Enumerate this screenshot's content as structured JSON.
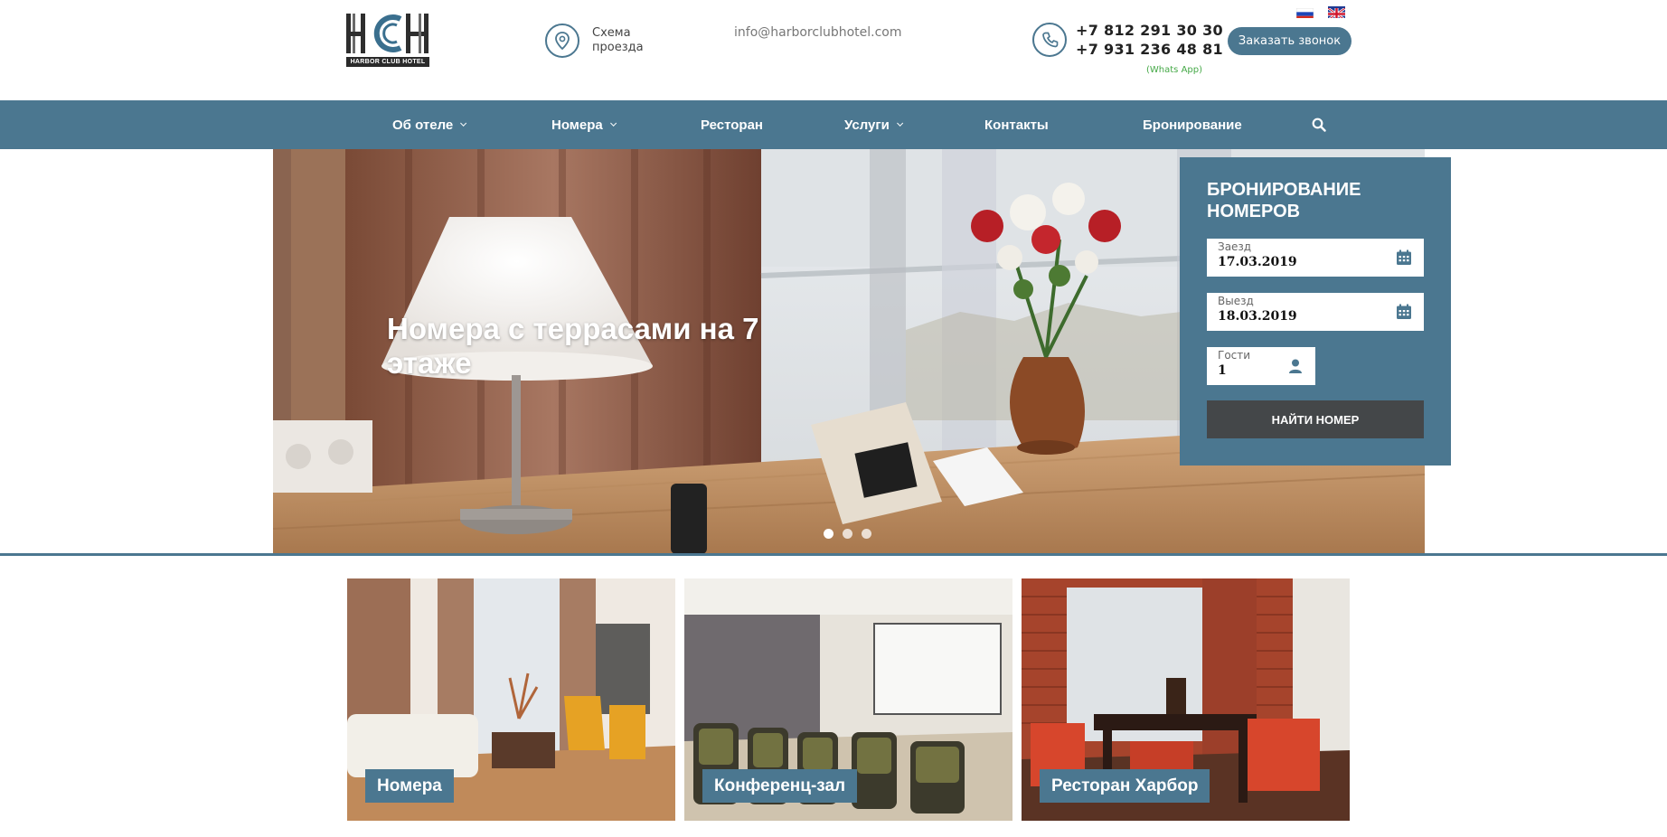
{
  "brand": {
    "logo_letters": "HCH",
    "logo_caption": "HARBOR CLUB HOTEL"
  },
  "header": {
    "map_link": "Схема проезда",
    "email": "info@harborclubhotel.com",
    "phone_1": "+7 812 291 30 30",
    "phone_2": "+7 931 236 48 81",
    "whatsapp": "(Whats App)",
    "callback_button": "Заказать звонок",
    "languages": [
      "ru",
      "en"
    ]
  },
  "nav": {
    "items": [
      {
        "label": "Об отеле",
        "dropdown": true
      },
      {
        "label": "Номера",
        "dropdown": true
      },
      {
        "label": "Ресторан",
        "dropdown": false
      },
      {
        "label": "Услуги",
        "dropdown": true
      },
      {
        "label": "Контакты",
        "dropdown": false
      },
      {
        "label": "Бронирование",
        "dropdown": false
      }
    ],
    "search_icon": "search-icon"
  },
  "hero": {
    "title": "Номера с террасами на 7 этаже",
    "slides_count": 3,
    "active_slide": 1
  },
  "booking": {
    "title": "БРОНИРОВАНИЕ НОМЕРОВ",
    "checkin_label": "Заезд",
    "checkin_value": "17.03.2019",
    "checkout_label": "Выезд",
    "checkout_value": "18.03.2019",
    "guests_label": "Гости",
    "guests_value": "1",
    "find_button": "НАЙТИ НОМЕР"
  },
  "tiles": [
    {
      "label": "Номера"
    },
    {
      "label": "Конференц-зал"
    },
    {
      "label": "Ресторан Харбор"
    }
  ],
  "colors": {
    "brand_blue": "#4b7790",
    "button_dark": "#444749",
    "whatsapp_green": "#44a846"
  }
}
